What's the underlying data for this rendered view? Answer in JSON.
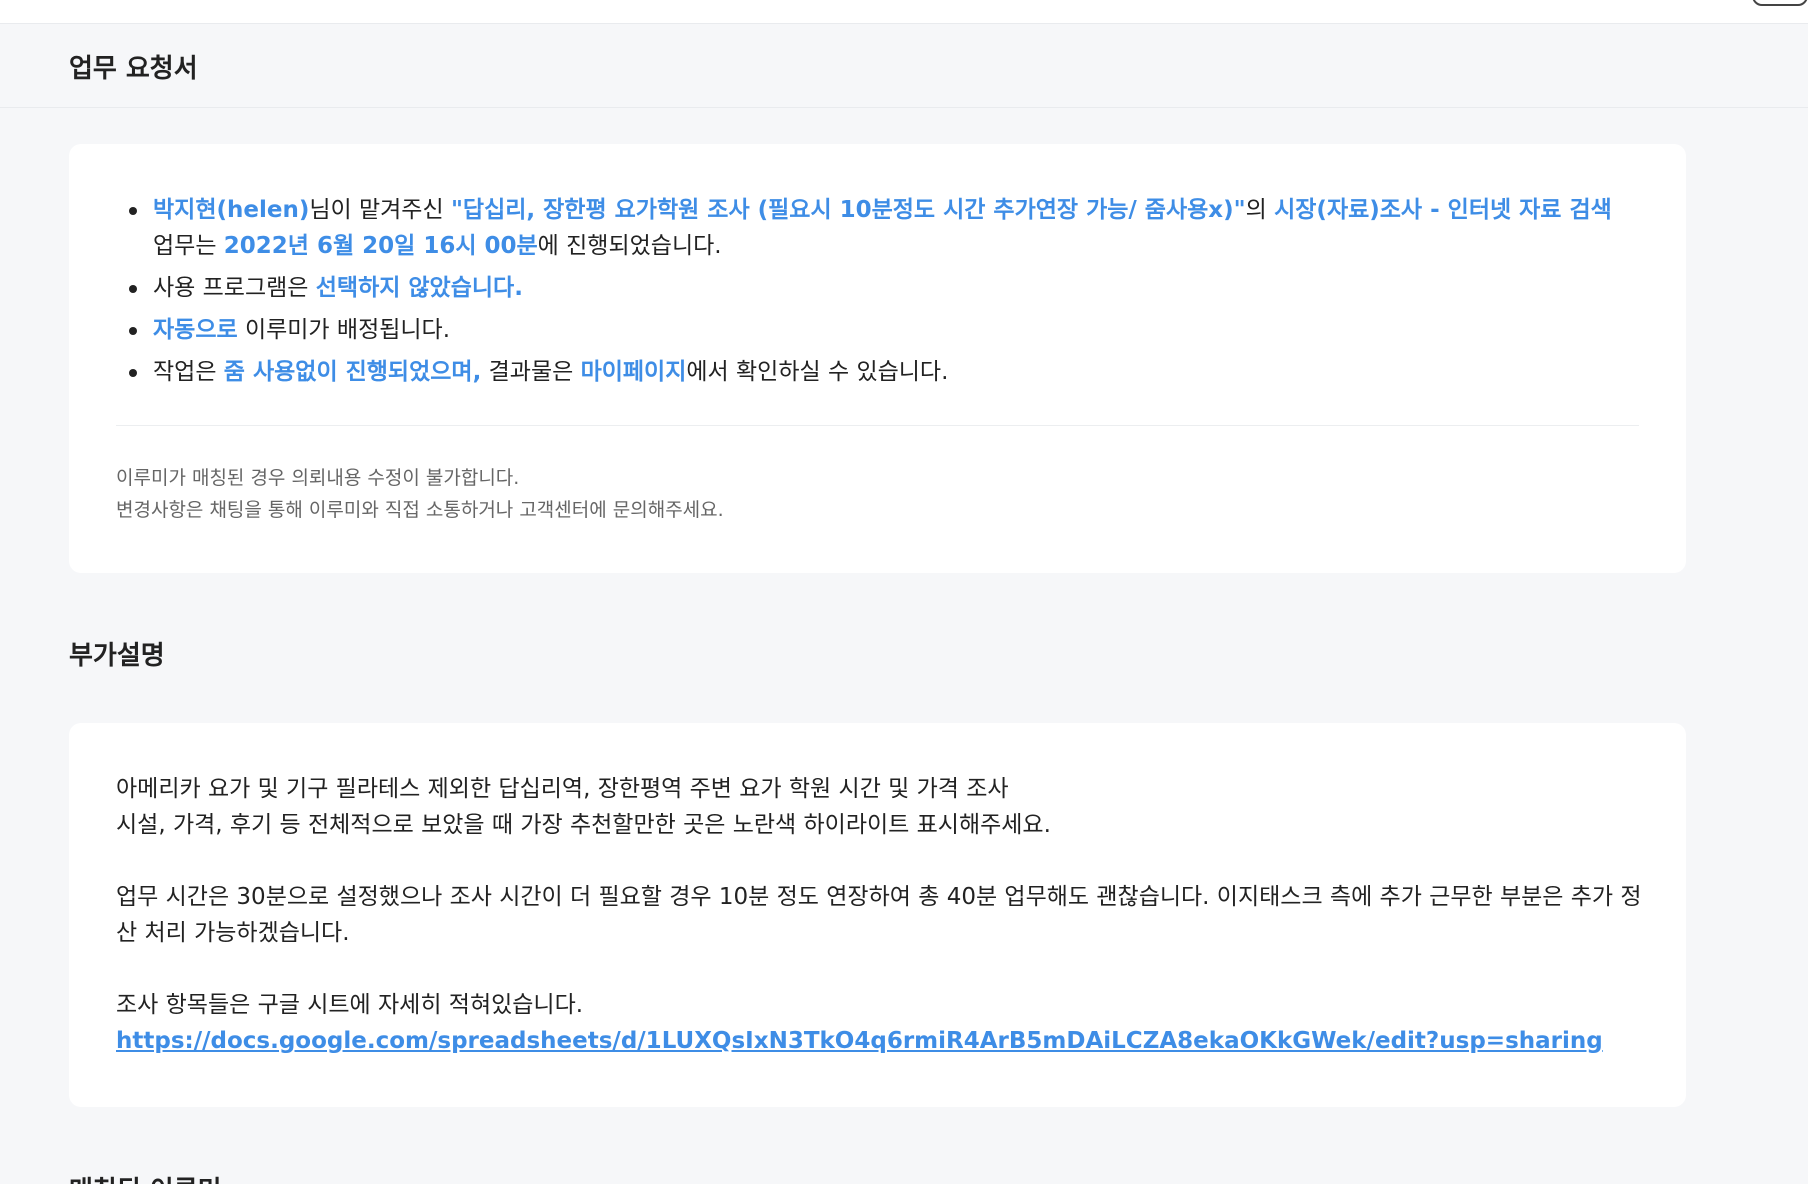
{
  "page": {
    "title": "업무 요청서"
  },
  "request": {
    "bullet1": {
      "requester": "박지현(helen)",
      "t1": "님이 맡겨주신 ",
      "task_title": "\"답십리, 장한평 요가학원 조사 (필요시 10분정도 시간 추가연장 가능/ 줌사용x)\"",
      "t2": "의 ",
      "category": "시장(자료)조사 - 인터넷 자료 검색",
      "t3": "업무는 ",
      "datetime": "2022년 6월 20일 16시 00분",
      "t4": "에 진행되었습니다."
    },
    "bullet2": {
      "t1": "사용 프로그램은 ",
      "program": "선택하지 않았습니다."
    },
    "bullet3": {
      "auto": "자동으로",
      "t1": " 이루미가 배정됩니다."
    },
    "bullet4": {
      "t1": "작업은 ",
      "zoom": "줌 사용없이 진행되었으며,",
      "t2": " 결과물은 ",
      "mypage": "마이페이지",
      "t3": "에서 확인하실 수 있습니다."
    },
    "notice_line1": "이루미가 매칭된 경우 의뢰내용 수정이 불가합니다.",
    "notice_line2": "변경사항은 채팅을 통해 이루미와 직접 소통하거나 고객센터에 문의해주세요."
  },
  "description": {
    "title": "부가설명",
    "para1_line1": "아메리카 요가 및 기구 필라테스 제외한 답십리역, 장한평역 주변 요가 학원 시간 및 가격 조사",
    "para1_line2": "시설, 가격, 후기 등 전체적으로 보았을 때 가장 추천할만한 곳은 노란색 하이라이트 표시해주세요.",
    "para2": "업무 시간은 30분으로 설정했으나 조사 시간이 더 필요할 경우 10분 정도 연장하여 총 40분 업무해도 괜찮습니다. 이지태스크 측에 추가 근무한 부분은 추가 정산 처리 가능하겠습니다.",
    "para3": "조사 항목들은 구글 시트에 자세히 적혀있습니다.",
    "link": "https://docs.google.com/spreadsheets/d/1LUXQsIxN3TkO4q6rmiR4ArB5mDAiLCZA8ekaOKkGWek/edit?usp=sharing"
  },
  "matched": {
    "title": "매칭된 이루미"
  },
  "colors": {
    "accent": "#3e8de6",
    "background": "#f6f7f9",
    "card": "#ffffff"
  }
}
